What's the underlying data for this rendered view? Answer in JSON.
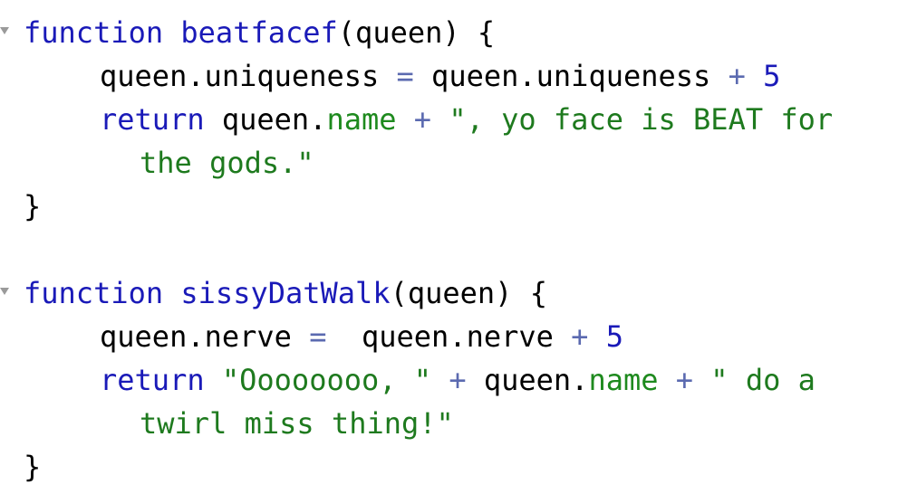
{
  "code": {
    "f1": {
      "keyword": "function",
      "name": "beatfacef",
      "params": "(queen) {",
      "l2_lhs": "queen.uniqueness",
      "l2_eq": "=",
      "l2_rhs": "queen.uniqueness",
      "l2_plus": "+",
      "l2_num": "5",
      "ret_kw": "return",
      "ret_obj": "queen.",
      "ret_prop": "name",
      "ret_plus": "+",
      "ret_str1": "\", yo face is BEAT for",
      "ret_str2": "the gods.\"",
      "close": "}"
    },
    "f2": {
      "keyword": "function",
      "name": "sissyDatWalk",
      "params": "(queen) {",
      "l2_lhs": "queen.nerve",
      "l2_eq": "=",
      "l2_rhs": "queen.nerve",
      "l2_plus": "+",
      "l2_num": "5",
      "ret_kw": "return",
      "ret_str_a": "\"Oooooooo, \"",
      "ret_plus1": "+",
      "ret_obj": "queen.",
      "ret_prop": "name",
      "ret_plus2": "+",
      "ret_str_b1": "\" do a",
      "ret_str_b2": "twirl miss thing!\"",
      "close": "}"
    }
  }
}
